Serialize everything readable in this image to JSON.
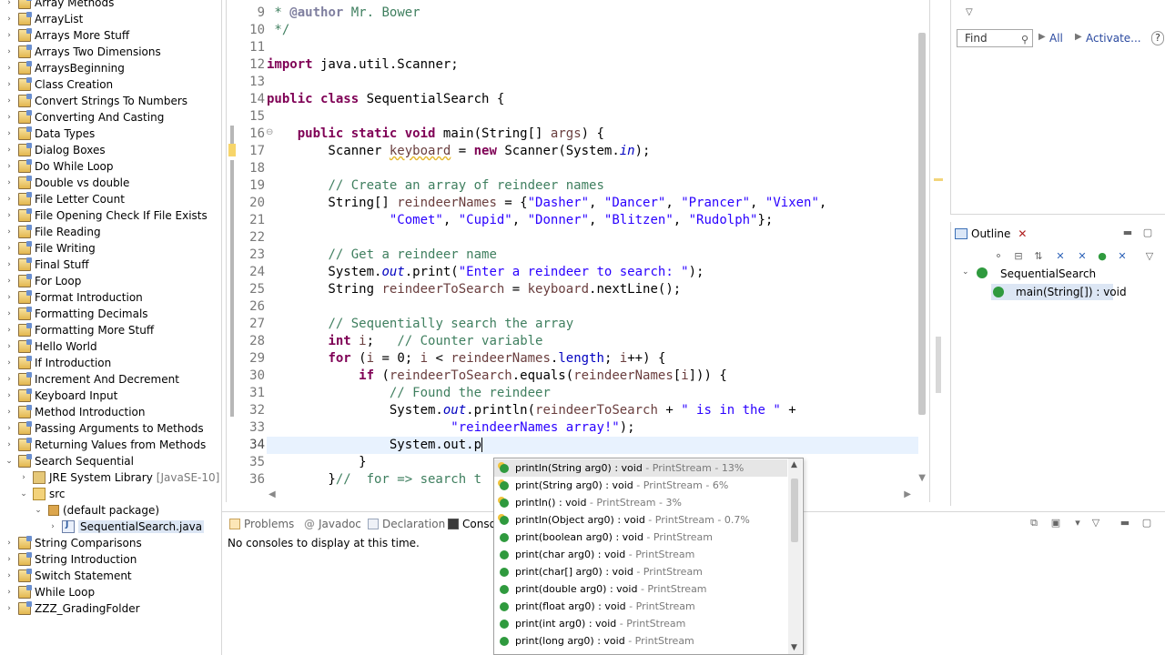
{
  "explorer": {
    "items": [
      {
        "label": "Array Methods",
        "arrow": "›",
        "icon": "project"
      },
      {
        "label": "ArrayList",
        "arrow": "›",
        "icon": "project"
      },
      {
        "label": "Arrays More Stuff",
        "arrow": "›",
        "icon": "project"
      },
      {
        "label": "Arrays Two Dimensions",
        "arrow": "›",
        "icon": "project"
      },
      {
        "label": "ArraysBeginning",
        "arrow": "›",
        "icon": "project"
      },
      {
        "label": "Class Creation",
        "arrow": "›",
        "icon": "project"
      },
      {
        "label": "Convert Strings To Numbers",
        "arrow": "›",
        "icon": "project"
      },
      {
        "label": "Converting And Casting",
        "arrow": "›",
        "icon": "project"
      },
      {
        "label": "Data Types",
        "arrow": "›",
        "icon": "project"
      },
      {
        "label": "Dialog Boxes",
        "arrow": "›",
        "icon": "project"
      },
      {
        "label": "Do While Loop",
        "arrow": "›",
        "icon": "project"
      },
      {
        "label": "Double vs double",
        "arrow": "›",
        "icon": "project"
      },
      {
        "label": "File Letter Count",
        "arrow": "›",
        "icon": "project"
      },
      {
        "label": "File Opening Check If File Exists",
        "arrow": "›",
        "icon": "project"
      },
      {
        "label": "File Reading",
        "arrow": "›",
        "icon": "project"
      },
      {
        "label": "File Writing",
        "arrow": "›",
        "icon": "project"
      },
      {
        "label": "Final Stuff",
        "arrow": "›",
        "icon": "project"
      },
      {
        "label": "For Loop",
        "arrow": "›",
        "icon": "project"
      },
      {
        "label": "Format Introduction",
        "arrow": "›",
        "icon": "project"
      },
      {
        "label": "Formatting Decimals",
        "arrow": "›",
        "icon": "project"
      },
      {
        "label": "Formatting More Stuff",
        "arrow": "›",
        "icon": "project"
      },
      {
        "label": "Hello World",
        "arrow": "›",
        "icon": "project"
      },
      {
        "label": "If Introduction",
        "arrow": "›",
        "icon": "project"
      },
      {
        "label": "Increment And Decrement",
        "arrow": "›",
        "icon": "project"
      },
      {
        "label": "Keyboard Input",
        "arrow": "›",
        "icon": "project"
      },
      {
        "label": "Method Introduction",
        "arrow": "›",
        "icon": "project"
      },
      {
        "label": "Passing Arguments to Methods",
        "arrow": "›",
        "icon": "project"
      },
      {
        "label": "Returning Values from Methods",
        "arrow": "›",
        "icon": "project"
      },
      {
        "label": "Search Sequential",
        "arrow": "⌄",
        "icon": "project"
      },
      {
        "label": "JRE System Library",
        "suffix": "[JavaSE-10]",
        "arrow": "›",
        "icon": "lib",
        "indent": 1
      },
      {
        "label": "src",
        "arrow": "⌄",
        "icon": "folder",
        "indent": 1
      },
      {
        "label": "(default package)",
        "arrow": "⌄",
        "icon": "pkg",
        "indent": 2
      },
      {
        "label": "SequentialSearch.java",
        "arrow": "›",
        "icon": "jfile",
        "indent": 3,
        "selected": true
      },
      {
        "label": "String Comparisons",
        "arrow": "›",
        "icon": "project"
      },
      {
        "label": "String Introduction",
        "arrow": "›",
        "icon": "project"
      },
      {
        "label": "Switch Statement",
        "arrow": "›",
        "icon": "project"
      },
      {
        "label": "While Loop",
        "arrow": "›",
        "icon": "project"
      },
      {
        "label": "ZZZ_GradingFolder",
        "arrow": "›",
        "icon": "project"
      }
    ]
  },
  "editor": {
    "lines": [
      {
        "num": "9",
        "html": "<span class=\"cm\"> * </span><span class=\"tag\">@author</span><span class=\"cm\"> Mr. Bower</span>"
      },
      {
        "num": "10",
        "html": "<span class=\"cm\"> */</span>"
      },
      {
        "num": "11",
        "html": ""
      },
      {
        "num": "12",
        "html": "<span class=\"kw\">import</span> java.util.Scanner;"
      },
      {
        "num": "13",
        "html": ""
      },
      {
        "num": "14",
        "html": "<span class=\"kw\">public</span> <span class=\"kw\">class</span> SequentialSearch {"
      },
      {
        "num": "15",
        "html": ""
      },
      {
        "num": "16",
        "html": "    <span class=\"kw\">public</span> <span class=\"kw\">static</span> <span class=\"kw\">void</span> main(String[] <span class=\"var\">args</span>) {"
      },
      {
        "num": "17",
        "html": "        Scanner <span class=\"var warnvar\">keyboard</span> = <span class=\"kw\">new</span> Scanner(System.<span class=\"fd\">in</span>);"
      },
      {
        "num": "18",
        "html": ""
      },
      {
        "num": "19",
        "html": "        <span class=\"cm\">// Create an array of reindeer names</span>"
      },
      {
        "num": "20",
        "html": "        String[] <span class=\"var\">reindeerNames</span> = {<span class=\"st\">\"Dasher\"</span>, <span class=\"st\">\"Dancer\"</span>, <span class=\"st\">\"Prancer\"</span>, <span class=\"st\">\"Vixen\"</span>,"
      },
      {
        "num": "21",
        "html": "                <span class=\"st\">\"Comet\"</span>, <span class=\"st\">\"Cupid\"</span>, <span class=\"st\">\"Donner\"</span>, <span class=\"st\">\"Blitzen\"</span>, <span class=\"st\">\"Rudolph\"</span>};"
      },
      {
        "num": "22",
        "html": ""
      },
      {
        "num": "23",
        "html": "        <span class=\"cm\">// Get a reindeer name</span>"
      },
      {
        "num": "24",
        "html": "        System.<span class=\"fd\">out</span>.print(<span class=\"st\">\"Enter a reindeer to search: \"</span>);"
      },
      {
        "num": "25",
        "html": "        String <span class=\"var\">reindeerToSearch</span> = <span class=\"var\">keyboard</span>.nextLine();"
      },
      {
        "num": "26",
        "html": ""
      },
      {
        "num": "27",
        "html": "        <span class=\"cm\">// Sequentially search the array</span>"
      },
      {
        "num": "28",
        "html": "        <span class=\"kw\">int</span> <span class=\"var\">i</span>;   <span class=\"cm\">// Counter variable</span>"
      },
      {
        "num": "29",
        "html": "        <span class=\"kw\">for</span> (<span class=\"var\">i</span> = 0; <span class=\"var\">i</span> &lt; <span class=\"var\">reindeerNames</span>.<span class=\"fd\" style=\"font-style:normal\">length</span>; <span class=\"var\">i</span>++) {"
      },
      {
        "num": "30",
        "html": "            <span class=\"kw\">if</span> (<span class=\"var\">reindeerToSearch</span>.equals(<span class=\"var\">reindeerNames</span>[<span class=\"var\">i</span>])) {"
      },
      {
        "num": "31",
        "html": "                <span class=\"cm\">// Found the reindeer</span>"
      },
      {
        "num": "32",
        "html": "                System.<span class=\"fd\">out</span>.println(<span class=\"var\">reindeerToSearch</span> + <span class=\"st\">\" is in the \"</span> +"
      },
      {
        "num": "33",
        "html": "                        <span class=\"st\">\"reindeerNames array!\"</span>);"
      },
      {
        "num": "34",
        "html": "                System.out.p<span class=\"caret\"></span>",
        "current": true
      },
      {
        "num": "35",
        "html": "            }"
      },
      {
        "num": "36",
        "html": "        }<span class=\"cm\">//  for =&gt; search t</span>"
      }
    ]
  },
  "find": {
    "placeholder": "Find",
    "all_label": "All",
    "activate_label": "Activate..."
  },
  "outline": {
    "tab_label": "Outline",
    "class_name": "SequentialSearch",
    "method_label": "main(String[]) : void"
  },
  "console": {
    "tabs": [
      "Problems",
      "Javadoc",
      "Declaration",
      "Conso"
    ],
    "message": "No consoles to display at this time."
  },
  "assist": {
    "proposals": [
      {
        "sig": "println(String arg0) : void",
        "type": " - PrintStream - 13%",
        "star": true,
        "selected": true
      },
      {
        "sig": "print(String arg0) : void",
        "type": " - PrintStream - 6%",
        "star": true
      },
      {
        "sig": "println() : void",
        "type": " - PrintStream - 3%",
        "star": true
      },
      {
        "sig": "println(Object arg0) : void",
        "type": " - PrintStream - 0.7%",
        "star": true
      },
      {
        "sig": "print(boolean arg0) : void",
        "type": " - PrintStream"
      },
      {
        "sig": "print(char arg0) : void",
        "type": " - PrintStream"
      },
      {
        "sig": "print(char[] arg0) : void",
        "type": " - PrintStream"
      },
      {
        "sig": "print(double arg0) : void",
        "type": " - PrintStream"
      },
      {
        "sig": "print(float arg0) : void",
        "type": " - PrintStream"
      },
      {
        "sig": "print(int arg0) : void",
        "type": " - PrintStream"
      },
      {
        "sig": "print(long arg0) : void",
        "type": " - PrintStream"
      }
    ]
  }
}
